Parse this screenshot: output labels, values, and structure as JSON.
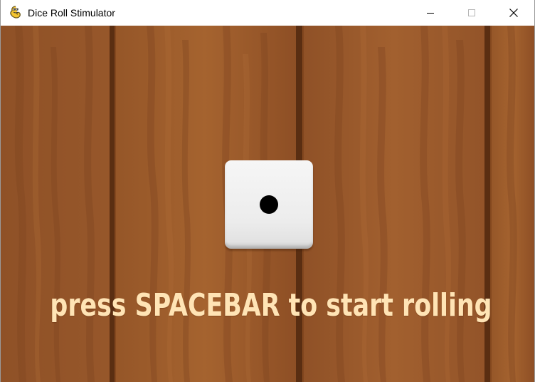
{
  "window": {
    "title": "Dice Roll Stimulator",
    "icon": "pygame-snake-icon",
    "controls": [
      "minimize-icon",
      "maximize-icon",
      "close-icon"
    ]
  },
  "game": {
    "die_value": 1,
    "prompt": "press SPACEBAR to start rolling",
    "colors": {
      "wood": "#9a5a2d",
      "plank_seam": "#5a2e12",
      "prompt_text": "#ffe4b5",
      "die_face": "#f2f2f2",
      "pip": "#000000"
    }
  }
}
